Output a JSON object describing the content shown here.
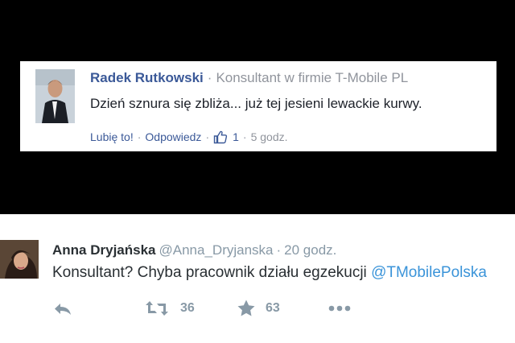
{
  "facebook_comment": {
    "author": "Radek Rutkowski",
    "separator": "·",
    "job": "Konsultant w firmie T-Mobile PL",
    "comment": "Dzień sznura się zbliża... już tej jesieni lewackie kurwy.",
    "actions": {
      "like": "Lubię to!",
      "dot1": "·",
      "reply": "Odpowiedz",
      "dot2": "·",
      "like_icon": "thumbs-up-icon",
      "like_count": "1",
      "dot3": "·",
      "time": "5 godz."
    }
  },
  "tweet": {
    "name": "Anna Dryjańska",
    "handle": "@Anna_Dryjanska",
    "dot": "·",
    "time": "20 godz.",
    "text": "Konsultant? Chyba pracownik działu egzekucji ",
    "mention": "@TMobilePolska",
    "actions": {
      "reply_icon": "reply-icon",
      "retweet_icon": "retweet-icon",
      "retweet_count": "36",
      "favorite_icon": "star-icon",
      "favorite_count": "63",
      "more_icon": "more-icon"
    }
  },
  "colors": {
    "fb_link": "#3b5998",
    "tw_link": "#3b94d9",
    "muted": "#8899a6"
  }
}
